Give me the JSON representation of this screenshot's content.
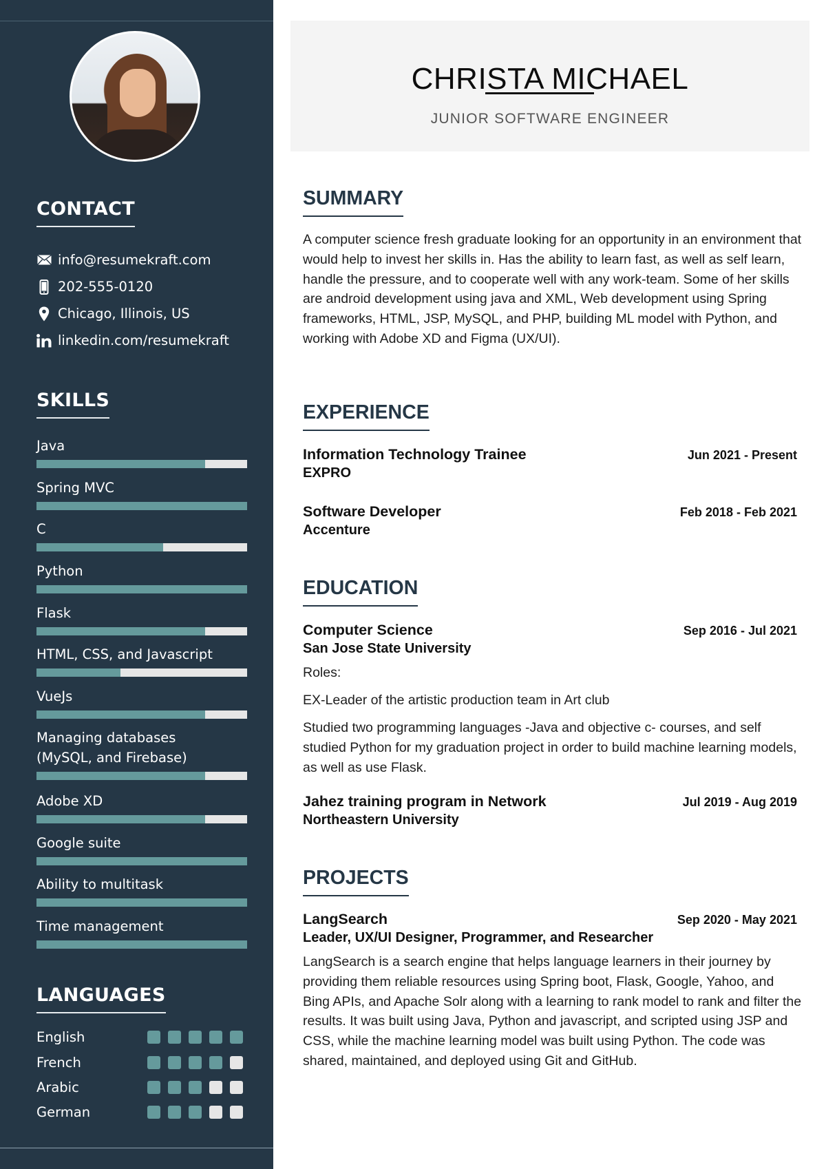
{
  "header": {
    "name": "CHRISTA MICHAEL",
    "title": "JUNIOR SOFTWARE ENGINEER"
  },
  "sidebar": {
    "contact": {
      "heading": "CONTACT",
      "items": [
        {
          "icon": "envelope-icon",
          "text": "info@resumekraft.com"
        },
        {
          "icon": "phone-icon",
          "text": "202-555-0120"
        },
        {
          "icon": "location-pin-icon",
          "text": "Chicago, Illinois, US"
        },
        {
          "icon": "linkedin-icon",
          "text": "linkedin.com/resumekraft"
        }
      ]
    },
    "skills": {
      "heading": "SKILLS",
      "items": [
        {
          "name": "Java",
          "level": 0.8
        },
        {
          "name": "Spring MVC",
          "level": 1.0
        },
        {
          "name": "C",
          "level": 0.6
        },
        {
          "name": "Python",
          "level": 1.0
        },
        {
          "name": "Flask",
          "level": 0.8
        },
        {
          "name": "HTML, CSS, and Javascript",
          "level": 0.4
        },
        {
          "name": "VueJs",
          "level": 0.8
        },
        {
          "name": "Managing databases (MySQL, and Firebase)",
          "level": 0.8
        },
        {
          "name": "Adobe XD",
          "level": 0.8
        },
        {
          "name": "Google suite",
          "level": 1.0
        },
        {
          "name": "Ability to multitask",
          "level": 1.0
        },
        {
          "name": "Time management",
          "level": 1.0
        }
      ]
    },
    "languages": {
      "heading": "LANGUAGES",
      "max": 5,
      "items": [
        {
          "name": "English",
          "level": 5
        },
        {
          "name": "French",
          "level": 4
        },
        {
          "name": "Arabic",
          "level": 3
        },
        {
          "name": "German",
          "level": 3
        }
      ]
    }
  },
  "summary": {
    "heading": "SUMMARY",
    "text": "A computer science fresh graduate looking for an opportunity in an environment that would help to invest her skills in. Has the ability to learn fast, as well as self learn, handle the pressure, and to cooperate well with any work-team. Some of her skills are android development using java and XML, Web development using Spring frameworks, HTML, JSP, MySQL, and PHP, building ML model with Python, and working with Adobe XD and Figma (UX/UI)."
  },
  "experience": {
    "heading": "EXPERIENCE",
    "items": [
      {
        "title": "Information Technology Trainee",
        "org": "EXPRO",
        "date": "Jun 2021 - Present"
      },
      {
        "title": "Software Developer",
        "org": "Accenture",
        "date": "Feb 2018 - Feb 2021"
      }
    ]
  },
  "education": {
    "heading": "EDUCATION",
    "items": [
      {
        "title": "Computer Science",
        "org": "San Jose State University",
        "date": "Sep 2016 - Jul 2021",
        "details": [
          "Roles:",
          "EX-Leader of the artistic production team in Art club",
          "Studied two programming languages -Java and objective c- courses, and self studied Python for my graduation project in order to build machine learning models, as well as use Flask."
        ]
      },
      {
        "title": "Jahez training program in Network",
        "org": "Northeastern University",
        "date": "Jul 2019 - Aug 2019"
      }
    ]
  },
  "projects": {
    "heading": "PROJECTS",
    "items": [
      {
        "title": "LangSearch",
        "role": "Leader, UX/UI Designer, Programmer, and Researcher",
        "date": "Sep 2020 - May 2021",
        "description": "LangSearch is a search engine that helps language learners in their journey by providing them reliable resources using Spring boot, Flask, Google, Yahoo, and Bing APIs, and Apache Solr along with a learning to rank model to rank and filter the results. It was built using Java, Python and javascript, and scripted using JSP and CSS, while the machine learning model was built using Python. The code was shared, maintained, and deployed using Git and GitHub."
      }
    ]
  },
  "colors": {
    "sidebar_bg": "#253746",
    "accent": "#659a9c",
    "bar_empty": "#e6e6e6",
    "header_bg": "#f4f4f4",
    "heading": "#253746"
  }
}
